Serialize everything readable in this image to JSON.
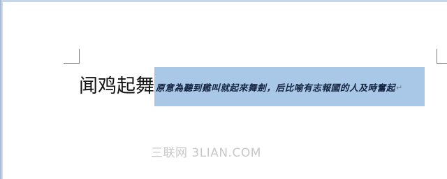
{
  "document": {
    "heading": "闻鸡起舞",
    "selected_text": "原意為聽到雞叫就起來舞劍，后比喻有志報國的人及時奮起",
    "paragraph_mark": "↵"
  },
  "watermark": {
    "text": "三联网 3LIAN.COM"
  },
  "colors": {
    "selection_highlight": "#a9c7e7",
    "window_frame": "#9fb4cf"
  }
}
